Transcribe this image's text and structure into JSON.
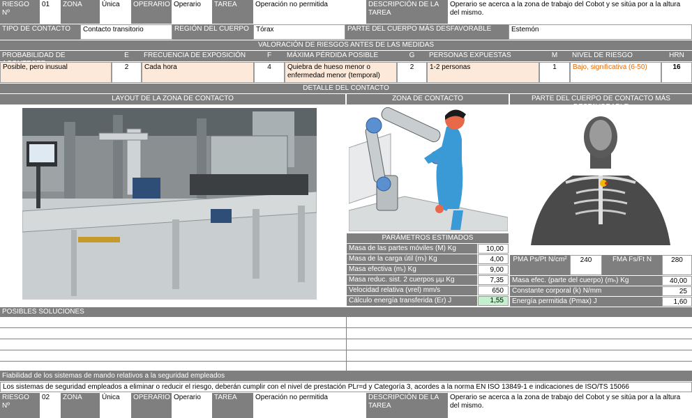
{
  "r1": {
    "riesgo_label": "RIESGO Nº",
    "riesgo": "01",
    "zona_label": "ZONA",
    "zona": "Única",
    "operario_label": "OPERARIO",
    "operario": "Operario",
    "tarea_label": "TAREA",
    "tarea": "Operación no permitida",
    "desc_label": "DESCRIPCIÓN DE LA TAREA",
    "desc": "Operario se acerca a la zona de trabajo del Cobot y se sitúa por a la altura del mismo."
  },
  "contact": {
    "tipo_label": "TIPO DE CONTACTO",
    "tipo": "Contacto transitorio",
    "region_label": "REGIÓN DEL CUERPO",
    "region": "Tórax",
    "parte_label": "PARTE DEL CUERPO MÁS DESFAVORABLE",
    "parte": "Estemón"
  },
  "valoracion": {
    "title": "VALORACIÓN DE RIESGOS ANTES DE LAS MEDIDAS",
    "headers": [
      "PROBABILIDAD DE ACONTECER",
      "E",
      "FRECUENCIA DE EXPOSICIÓN",
      "F",
      "MÁXIMA PÉRDIDA POSIBLE",
      "G",
      "PERSONAS EXPUESTAS",
      "M",
      "NIVEL DE RIESGO",
      "HRN"
    ],
    "values": [
      "Posible, pero inusual",
      "2",
      "Cada hora",
      "4",
      "Quiebra de hueso menor o enfermedad menor (temporal)",
      "2",
      "1-2 personas",
      "1",
      "Bajo, significativa (6-50)",
      "16"
    ]
  },
  "detalle": {
    "title": "DETALLE DEL CONTACTO",
    "layout_label": "LAYOUT DE LA ZONA DE CONTACTO",
    "zona_label": "ZONA DE CONTACTO",
    "parte_label": "PARTE DEL CUERPO DE CONTACTO MÁS DESFAVORABLE"
  },
  "params": {
    "title": "PARÁMETROS ESTIMADOS",
    "rows": [
      {
        "label": "Masa de las partes móviles (M) Kg",
        "value": "10,00"
      },
      {
        "label": "Masa de la carga útil (mₗ) Kg",
        "value": "4,00"
      },
      {
        "label": "Masa efectiva (mᵣ) Kg",
        "value": "9,00"
      },
      {
        "label": "Masa reduc. sist. 2 cuerpos µµ Kg",
        "value": "7,35"
      },
      {
        "label": "Velocidad relativa (vrel) mm/s",
        "value": "650"
      },
      {
        "label": "Cálculo energía transferida (Er) J",
        "value": "1,55"
      }
    ],
    "pma_label": "PMA Ps/Pt N/cm²",
    "pma": "240",
    "fma_label": "FMA Fs/Ft N",
    "fma": "280",
    "right_rows": [
      {
        "label": "Masa efec. (parte del cuerpo) (mₕ) Kg",
        "value": "40,00"
      },
      {
        "label": "Constante corporal (k) N/mm",
        "value": "25"
      },
      {
        "label": "Energía permitida (Pmax) J",
        "value": "1,60"
      }
    ]
  },
  "soluciones": {
    "title": "POSIBLES SOLUCIONES"
  },
  "fiabilidad": {
    "title": "Fiabilidad de los sistemas de mando  relativos a la seguridad empleados",
    "text": "Los sistemas de seguridad empleados a eliminar o reducir el riesgo, deberán cumplir con el nivel de prestación PLr=d y Categoría 3, acordes a la norma EN ISO 13849-1 e indicaciones de ISO/TS 15066"
  },
  "r2": {
    "riesgo_label": "RIESGO Nº",
    "riesgo": "02",
    "zona_label": "ZONA",
    "zona": "Única",
    "operario_label": "OPERARIO",
    "operario": "Operario",
    "tarea_label": "TAREA",
    "tarea": "Operación no permitida",
    "desc_label": "DESCRIPCIÓN DE LA TAREA",
    "desc": "Operario se acerca a la zona de trabajo del Cobot y se sitúa por a la altura del mismo."
  },
  "colors": {
    "header": "#7f7f7f",
    "peach": "#fde9d9",
    "risk": "#e46c0a",
    "ok": "#c6efce"
  }
}
